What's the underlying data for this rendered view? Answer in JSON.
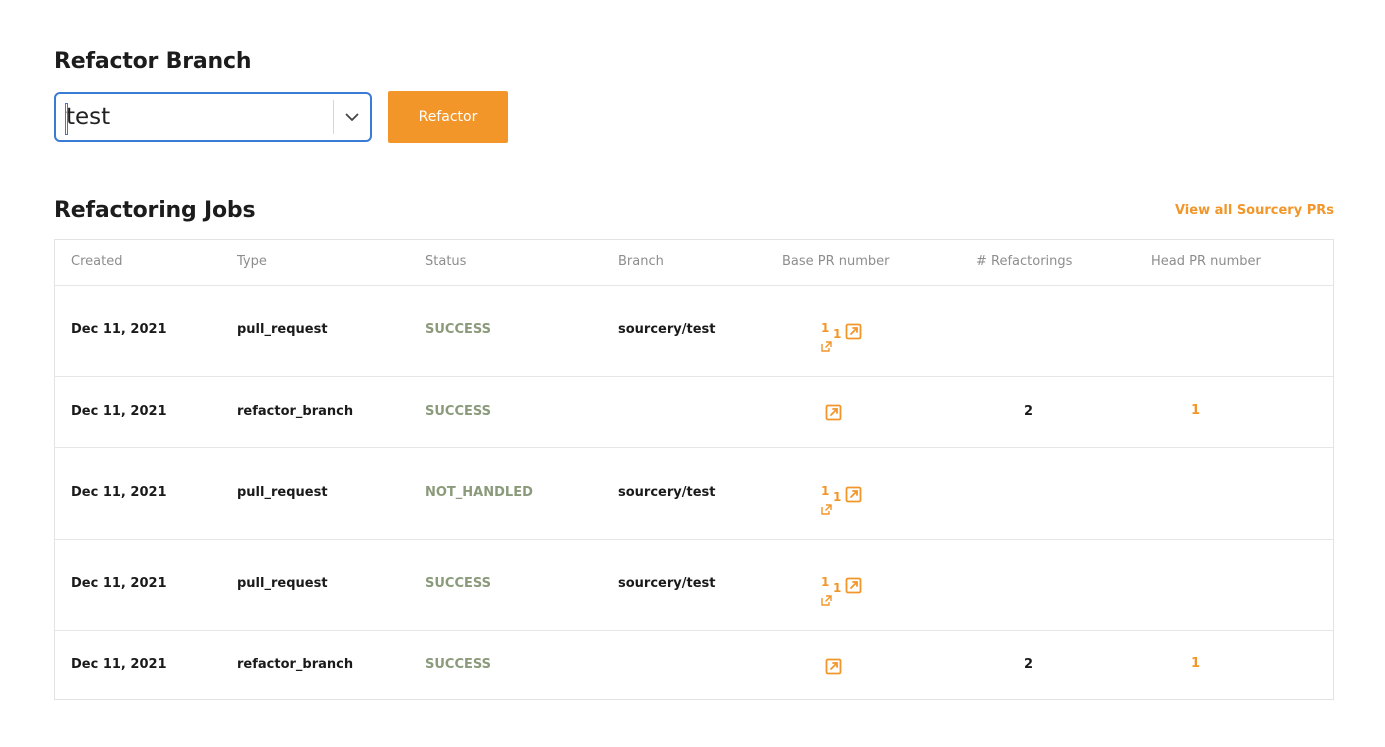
{
  "refactor_branch": {
    "title": "Refactor Branch",
    "select_value": "test",
    "button_label": "Refactor"
  },
  "jobs": {
    "title": "Refactoring Jobs",
    "view_all_label": "View all Sourcery PRs",
    "columns": [
      "Created",
      "Type",
      "Status",
      "Branch",
      "Base PR number",
      "# Refactorings",
      "Head PR number"
    ],
    "rows": [
      {
        "created": "Dec 11, 2021",
        "type": "pull_request",
        "status": "SUCCESS",
        "branch": "sourcery/test",
        "base_pr": "1",
        "base_pr_link": "1",
        "refactorings": "",
        "head_pr": ""
      },
      {
        "created": "Dec 11, 2021",
        "type": "refactor_branch",
        "status": "SUCCESS",
        "branch": "",
        "base_pr": "",
        "base_pr_link": "",
        "refactorings": "2",
        "head_pr": "1"
      },
      {
        "created": "Dec 11, 2021",
        "type": "pull_request",
        "status": "NOT_HANDLED",
        "branch": "sourcery/test",
        "base_pr": "1",
        "base_pr_link": "1",
        "refactorings": "",
        "head_pr": ""
      },
      {
        "created": "Dec 11, 2021",
        "type": "pull_request",
        "status": "SUCCESS",
        "branch": "sourcery/test",
        "base_pr": "1",
        "base_pr_link": "1",
        "refactorings": "",
        "head_pr": ""
      },
      {
        "created": "Dec 11, 2021",
        "type": "refactor_branch",
        "status": "SUCCESS",
        "branch": "",
        "base_pr": "",
        "base_pr_link": "",
        "refactorings": "2",
        "head_pr": "1"
      }
    ]
  },
  "colors": {
    "accent": "#f2962a",
    "focus": "#3a7bd5",
    "status": "#8a9a7a"
  },
  "icons": {
    "external_link": "external-link-icon",
    "chevron": "chevron-down-icon"
  }
}
